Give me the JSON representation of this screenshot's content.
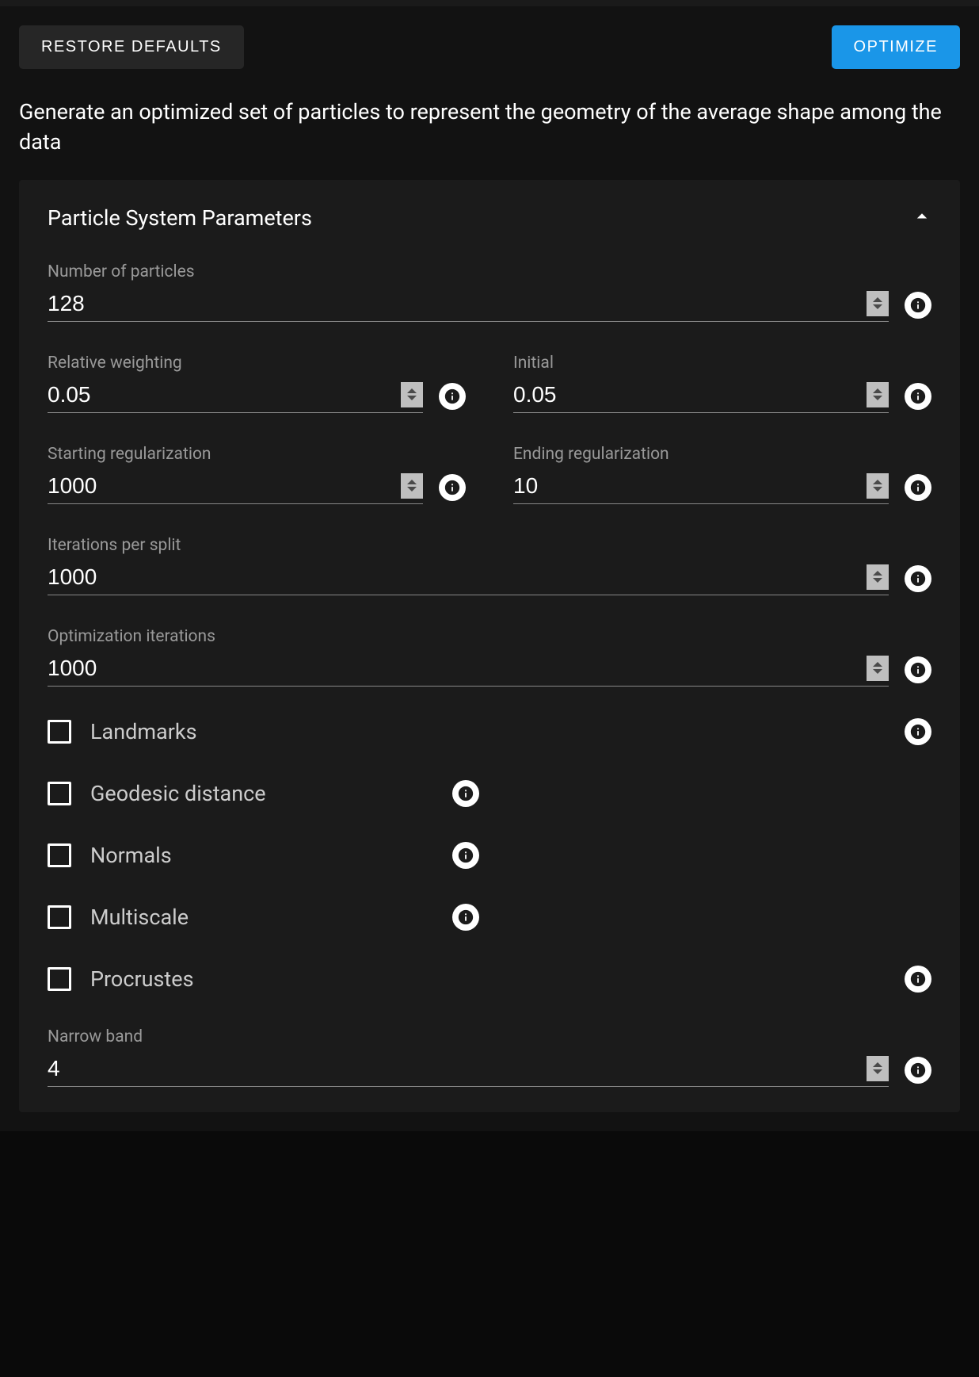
{
  "topbar": {
    "restore_label": "Restore Defaults",
    "optimize_label": "Optimize"
  },
  "description": "Generate an optimized set of particles to represent the geometry of the average shape among the data",
  "section": {
    "title": "Particle System Parameters"
  },
  "fields": {
    "num_particles": {
      "label": "Number of particles",
      "value": "128"
    },
    "relative_weighting": {
      "label": "Relative weighting",
      "value": "0.05"
    },
    "initial": {
      "label": "Initial",
      "value": "0.05"
    },
    "starting_reg": {
      "label": "Starting regularization",
      "value": "1000"
    },
    "ending_reg": {
      "label": "Ending regularization",
      "value": "10"
    },
    "iter_per_split": {
      "label": "Iterations per split",
      "value": "1000"
    },
    "opt_iterations": {
      "label": "Optimization iterations",
      "value": "1000"
    },
    "narrow_band": {
      "label": "Narrow band",
      "value": "4"
    }
  },
  "checkboxes": {
    "landmarks": "Landmarks",
    "geodesic": "Geodesic distance",
    "normals": "Normals",
    "multiscale": "Multiscale",
    "procrustes": "Procrustes"
  }
}
